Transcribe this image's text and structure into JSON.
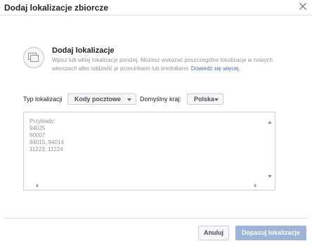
{
  "dialog": {
    "title": "Dodaj lokalizacje zbiorcze"
  },
  "intro": {
    "title": "Dodaj lokalizacje",
    "description": "Wpisz lub wklej lokalizacje poniżej. Możesz wskazać poszczególne lokalizacje w nowych wierszach albo oddzielić je przecinkami lub średnikami.",
    "learn_more_label": "Dowiedz się więcej."
  },
  "controls": {
    "location_type_label": "Typ lokalizacji",
    "location_type_value": "Kody pocztowe",
    "default_country_label": "Domyślny kraj:",
    "default_country_value": "Polska"
  },
  "textarea": {
    "placeholder_lines": "Przykłady:\n94025\n90007\n94015, 94014\n11223; 11224"
  },
  "footer": {
    "cancel_label": "Anuluj",
    "apply_label": "Dopasuj lokalizacje"
  },
  "icons": {
    "close": "close-icon",
    "intro": "bulk-locations-icon"
  },
  "colors": {
    "link": "#4267b2",
    "apply_button_disabled": "#9cb4d8"
  }
}
